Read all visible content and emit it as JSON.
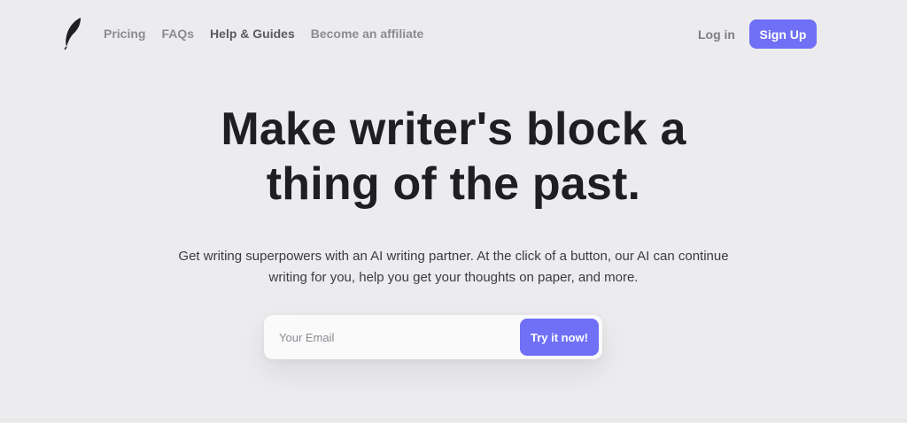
{
  "header": {
    "logo_icon": "feather-icon",
    "nav": [
      {
        "label": "Pricing"
      },
      {
        "label": "FAQs"
      },
      {
        "label": "Help & Guides"
      },
      {
        "label": "Become an affiliate"
      }
    ],
    "login_label": "Log in",
    "signup_label": "Sign Up"
  },
  "hero": {
    "title": "Make writer's block a thing of the past.",
    "subtitle": "Get writing superpowers with an AI writing partner. At the click of a button, our AI can continue writing for you, help you get your thoughts on paper, and more."
  },
  "signup_form": {
    "email_placeholder": "Your Email",
    "submit_label": "Try it now!"
  },
  "colors": {
    "background": "#ececee",
    "accent": "#6f70f5",
    "text_primary": "#1f1f22",
    "nav_text": "#8b8b92"
  }
}
